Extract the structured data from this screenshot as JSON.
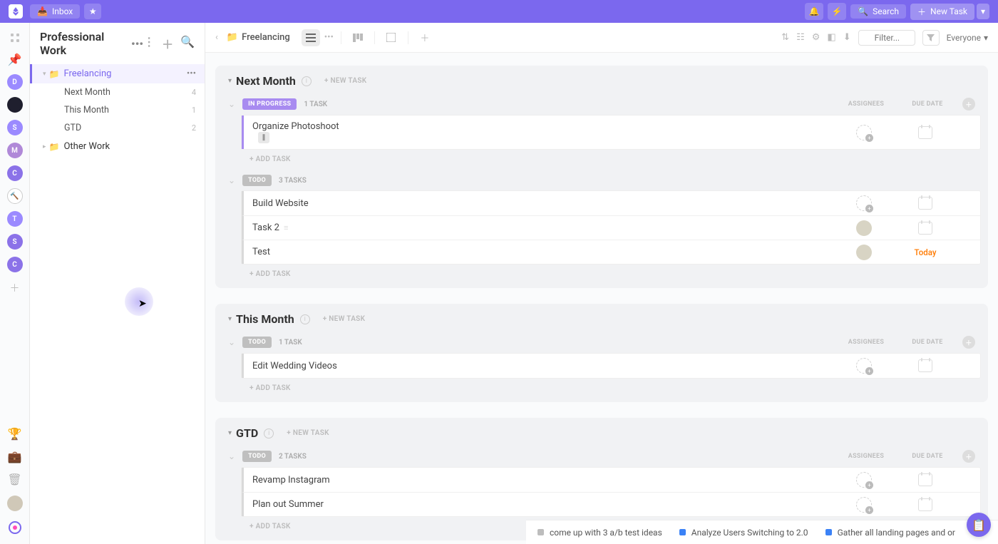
{
  "topbar": {
    "inbox_label": "Inbox",
    "search_label": "Search",
    "new_task_label": "New Task"
  },
  "sidebar": {
    "workspace_title": "Professional Work",
    "folders": {
      "freelancing": {
        "name": "Freelancing"
      },
      "other": {
        "name": "Other Work"
      }
    },
    "lists": [
      {
        "name": "Next Month",
        "count": "4"
      },
      {
        "name": "This Month",
        "count": "1"
      },
      {
        "name": "GTD",
        "count": "2"
      }
    ]
  },
  "rail": {
    "dots": [
      {
        "letter": "D",
        "color": "#9b8aff"
      },
      {
        "letter": "",
        "color": "#1f1f2e"
      },
      {
        "letter": "S",
        "color": "#9b8aff"
      },
      {
        "letter": "M",
        "color": "#b089d8"
      },
      {
        "letter": "C",
        "color": "#8b72e8"
      },
      {
        "letter": "🔨",
        "color": "#ffffff"
      },
      {
        "letter": "T",
        "color": "#9b8aff"
      },
      {
        "letter": "S",
        "color": "#8b72e8"
      },
      {
        "letter": "C",
        "color": "#8b72e8"
      }
    ]
  },
  "breadcrumb": {
    "folder": "Freelancing"
  },
  "toolbar": {
    "filter_placeholder": "Filter...",
    "everyone_label": "Everyone"
  },
  "labels": {
    "new_task_link": "+ NEW TASK",
    "add_task": "+ ADD TASK",
    "assignees": "ASSIGNEES",
    "due_date": "DUE DATE",
    "task_singular": "TASK",
    "tasks_plural": "TASKS"
  },
  "statuses": {
    "in_progress": {
      "label": "IN PROGRESS",
      "color": "#a88bf0"
    },
    "todo": {
      "label": "TODO",
      "color": "#bfbfbf"
    }
  },
  "groups": [
    {
      "title": "Next Month",
      "sections": [
        {
          "status": "in_progress",
          "count": "1 TASK",
          "show_headers": true,
          "tasks": [
            {
              "name": "Organize Photoshoot",
              "border": "#a88bf0",
              "badge": true
            }
          ]
        },
        {
          "status": "todo",
          "count": "3 TASKS",
          "show_headers": false,
          "tasks": [
            {
              "name": "Build Website",
              "border": "#d9d9d9"
            },
            {
              "name": "Task 2",
              "border": "#d9d9d9",
              "avatar": true,
              "subtle_icon": true
            },
            {
              "name": "Test",
              "border": "#d9d9d9",
              "avatar": true,
              "due_text": "Today",
              "due_color": "#ff7a00"
            }
          ]
        }
      ]
    },
    {
      "title": "This Month",
      "sections": [
        {
          "status": "todo",
          "count": "1 TASK",
          "show_headers": true,
          "tasks": [
            {
              "name": "Edit Wedding Videos",
              "border": "#d9d9d9"
            }
          ]
        }
      ]
    },
    {
      "title": "GTD",
      "sections": [
        {
          "status": "todo",
          "count": "2 TASKS",
          "show_headers": true,
          "tasks": [
            {
              "name": "Revamp Instagram",
              "border": "#d9d9d9"
            },
            {
              "name": "Plan out Summer",
              "border": "#d9d9d9"
            }
          ]
        }
      ]
    }
  ],
  "ticker": [
    {
      "color": "#bdbdbd",
      "text": "come up with 3 a/b test ideas"
    },
    {
      "color": "#3b82f6",
      "text": "Analyze Users Switching to 2.0"
    },
    {
      "color": "#3b82f6",
      "text": "Gather all landing pages and or"
    }
  ]
}
